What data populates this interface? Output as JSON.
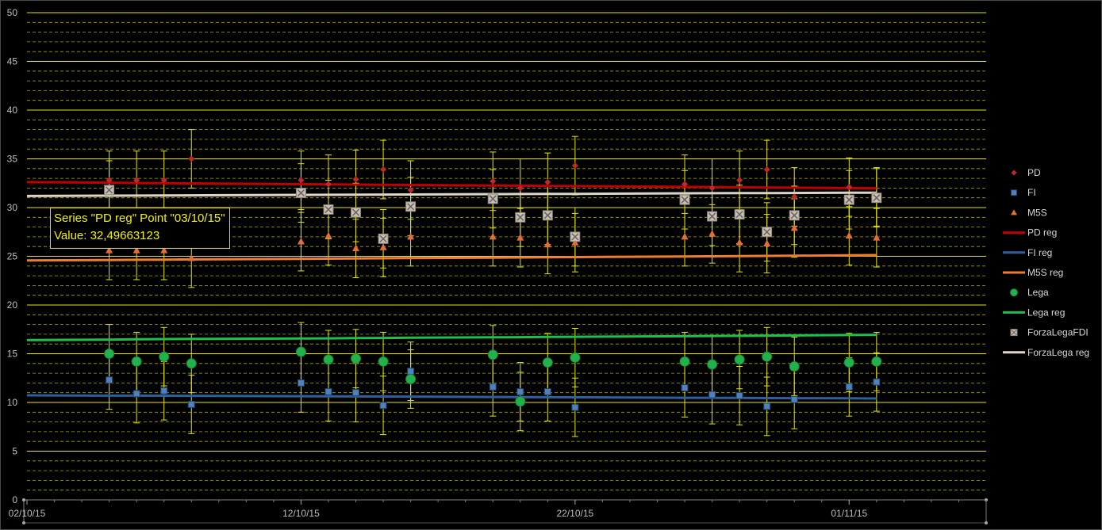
{
  "chart_data": {
    "type": "scatter",
    "title": "",
    "xlabel": "",
    "ylabel": "",
    "ylim": [
      0,
      50
    ],
    "y_major_step": 5,
    "y_minor_step": 1,
    "x_range": [
      "2015-10-02",
      "2015-11-06"
    ],
    "x_ticks": [
      {
        "date": "2015-10-02",
        "label": "02/10/15"
      },
      {
        "date": "2015-10-12",
        "label": "12/10/15"
      },
      {
        "date": "2015-10-22",
        "label": "22/10/15"
      },
      {
        "date": "2015-11-01",
        "label": "01/11/15"
      }
    ],
    "grid": {
      "major": true,
      "minor": true,
      "style": "yellow",
      "minor_dashed": true
    },
    "legend_position": "right",
    "error_margin": 3,
    "dates": [
      "2015-10-05",
      "2015-10-06",
      "2015-10-07",
      "2015-10-08",
      "2015-10-12",
      "2015-10-13",
      "2015-10-14",
      "2015-10-15",
      "2015-10-16",
      "2015-10-19",
      "2015-10-20",
      "2015-10-21",
      "2015-10-22",
      "2015-10-26",
      "2015-10-27",
      "2015-10-28",
      "2015-10-29",
      "2015-10-30",
      "2015-11-01",
      "2015-11-02"
    ],
    "series": [
      {
        "name": "PD",
        "kind": "marker",
        "marker": "diamond",
        "color": "#c0282d",
        "values": [
          32.8,
          32.8,
          32.8,
          35.0,
          32.8,
          32.4,
          32.9,
          33.9,
          31.8,
          32.7,
          32.0,
          32.6,
          34.3,
          32.4,
          32.0,
          32.8,
          33.9,
          31.1,
          32.1,
          31.1
        ]
      },
      {
        "name": "FI",
        "kind": "marker",
        "marker": "square",
        "color": "#4f81bd",
        "values": [
          12.3,
          10.9,
          11.2,
          9.8,
          12.0,
          11.1,
          11.0,
          9.7,
          13.2,
          11.6,
          11.1,
          11.1,
          9.5,
          11.5,
          10.8,
          10.7,
          9.6,
          10.3,
          11.6,
          12.1
        ]
      },
      {
        "name": "M5S",
        "kind": "marker",
        "marker": "triangle",
        "color": "#e46c3a",
        "values": [
          25.6,
          25.6,
          25.6,
          24.8,
          26.5,
          27.1,
          25.8,
          25.9,
          27.0,
          27.0,
          26.9,
          26.2,
          26.4,
          27.0,
          27.3,
          26.4,
          26.3,
          27.9,
          27.1,
          26.9
        ]
      },
      {
        "name": "PD reg",
        "kind": "line",
        "color": "#c00000",
        "values": [
          32.55,
          32.52,
          32.5,
          32.48,
          32.4,
          32.38,
          32.36,
          32.34,
          32.32,
          32.26,
          32.24,
          32.22,
          32.2,
          32.12,
          32.1,
          32.08,
          32.06,
          32.04,
          32.0,
          31.98
        ]
      },
      {
        "name": "FI reg",
        "kind": "line",
        "color": "#2e5f9e",
        "values": [
          10.7,
          10.7,
          10.69,
          10.68,
          10.64,
          10.63,
          10.62,
          10.61,
          10.6,
          10.56,
          10.55,
          10.54,
          10.53,
          10.48,
          10.47,
          10.46,
          10.45,
          10.44,
          10.42,
          10.41
        ]
      },
      {
        "name": "M5S reg",
        "kind": "line",
        "color": "#ed7d31",
        "values": [
          24.62,
          24.64,
          24.66,
          24.68,
          24.74,
          24.76,
          24.78,
          24.8,
          24.82,
          24.86,
          24.88,
          24.9,
          24.92,
          24.98,
          25.0,
          25.02,
          25.04,
          25.06,
          25.1,
          25.12
        ]
      },
      {
        "name": "Lega",
        "kind": "marker",
        "marker": "circle",
        "color": "#23b14d",
        "values": [
          15.0,
          14.2,
          14.7,
          14.0,
          15.2,
          14.4,
          14.5,
          14.2,
          12.4,
          14.9,
          10.1,
          14.1,
          14.6,
          14.2,
          13.9,
          14.4,
          14.7,
          13.7,
          14.1,
          14.2
        ]
      },
      {
        "name": "Lega reg",
        "kind": "line",
        "color": "#1fbf4e",
        "values": [
          16.45,
          16.48,
          16.5,
          16.52,
          16.56,
          16.58,
          16.6,
          16.62,
          16.64,
          16.68,
          16.7,
          16.72,
          16.74,
          16.8,
          16.82,
          16.84,
          16.86,
          16.88,
          16.92,
          16.94
        ]
      },
      {
        "name": "ForzaLegaFDI",
        "kind": "marker",
        "marker": "boxx",
        "color": "#c8c0b8",
        "values": [
          31.8,
          null,
          null,
          null,
          31.5,
          29.8,
          29.5,
          26.8,
          30.1,
          30.9,
          29.0,
          29.2,
          27.0,
          30.8,
          29.1,
          29.3,
          27.5,
          29.2,
          30.8,
          31.0
        ]
      },
      {
        "name": "ForzaLega reg",
        "kind": "line",
        "color": "#ddd6c8",
        "values": [
          31.22,
          31.23,
          31.24,
          31.25,
          31.3,
          31.31,
          31.32,
          31.33,
          31.34,
          31.38,
          31.39,
          31.4,
          31.41,
          31.46,
          31.47,
          31.48,
          31.49,
          31.5,
          31.52,
          31.53
        ]
      }
    ]
  },
  "tooltip": {
    "line1": "Series \"PD reg\" Point \"03/10/15\"",
    "line2": "Value: 32,49663123"
  }
}
